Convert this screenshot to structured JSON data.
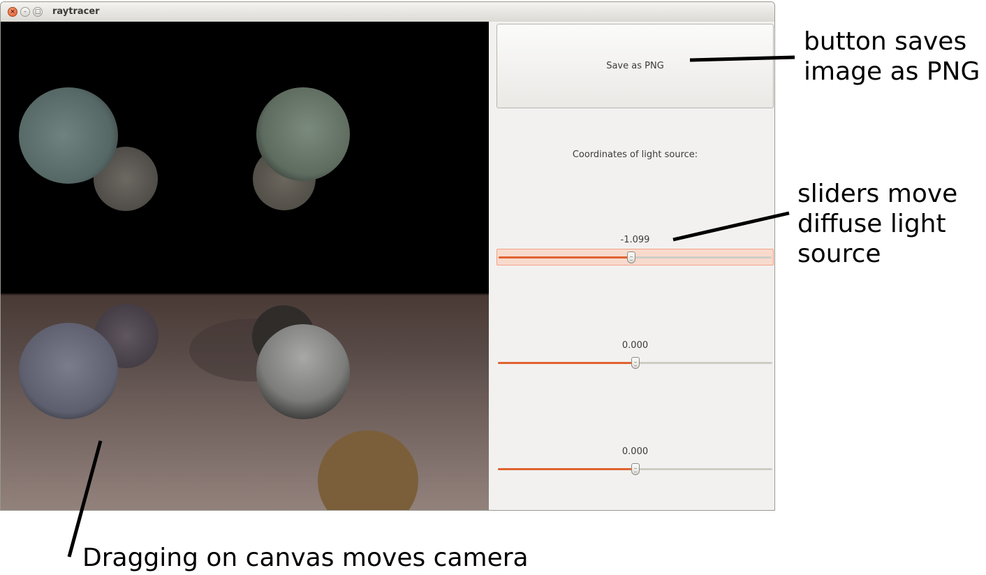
{
  "window": {
    "title": "raytracer",
    "close_glyph": "×",
    "min_glyph": "–",
    "max_glyph": "□"
  },
  "panel": {
    "save_button_label": "Save as PNG",
    "coordinates_label": "Coordinates of light source:",
    "sliders": [
      {
        "value_text": "-1.099",
        "fraction": 0.486
      },
      {
        "value_text": "0.000",
        "fraction": 0.5
      },
      {
        "value_text": "0.000",
        "fraction": 0.5
      }
    ]
  },
  "annotations": {
    "button": [
      "button saves",
      "image as PNG"
    ],
    "sliders": [
      "sliders move",
      "diffuse light",
      "source"
    ],
    "canvas": "Dragging on canvas moves camera"
  },
  "colors": {
    "accent": "#e0632f",
    "focus_bg": "#f8dacd"
  }
}
